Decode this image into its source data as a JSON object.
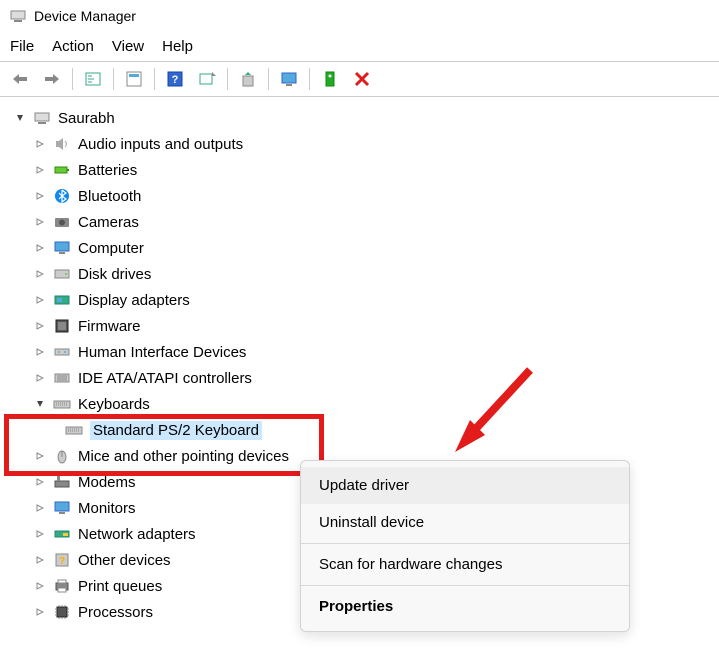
{
  "window": {
    "title": "Device Manager"
  },
  "menu": [
    "File",
    "Action",
    "View",
    "Help"
  ],
  "tree": {
    "root": "Saurabh",
    "items": [
      "Audio inputs and outputs",
      "Batteries",
      "Bluetooth",
      "Cameras",
      "Computer",
      "Disk drives",
      "Display adapters",
      "Firmware",
      "Human Interface Devices",
      "IDE ATA/ATAPI controllers",
      "Keyboards",
      "Mice and other pointing devices",
      "Modems",
      "Monitors",
      "Network adapters",
      "Other devices",
      "Print queues",
      "Processors"
    ],
    "keyboards_child": "Standard PS/2 Keyboard"
  },
  "context_menu": {
    "items": [
      "Update driver",
      "Uninstall device",
      "Scan for hardware changes",
      "Properties"
    ]
  }
}
